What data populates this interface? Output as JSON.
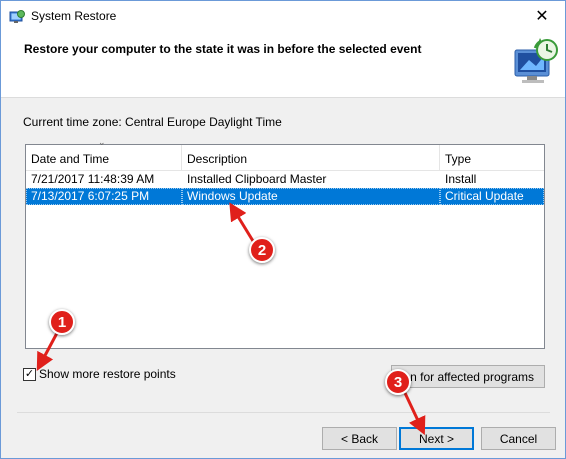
{
  "window": {
    "title": "System Restore",
    "close_glyph": "✕"
  },
  "header": {
    "title": "Restore your computer to the state it was in before the selected event"
  },
  "timezone": {
    "label": "Current time zone: Central Europe Daylight Time"
  },
  "table": {
    "columns": [
      "Date and Time",
      "Description",
      "Type"
    ],
    "rows": [
      {
        "datetime": "7/21/2017 11:48:39 AM",
        "description": "Installed Clipboard Master",
        "type": "Install"
      },
      {
        "datetime": "7/13/2017 6:07:25 PM",
        "description": "Windows Update",
        "type": "Critical Update"
      }
    ],
    "selected_row": 1
  },
  "show_more": {
    "label": "Show more restore points",
    "checked": true
  },
  "buttons": {
    "scan": "an for affected programs",
    "back": "< Back",
    "next": "Next >",
    "cancel": "Cancel"
  },
  "markers": {
    "m1": "1",
    "m2": "2",
    "m3": "3"
  },
  "icons": {
    "app": "system-restore-icon",
    "header": "computer-clock-icon"
  },
  "colors": {
    "selection": "#0078d7",
    "marker": "#e0201b"
  }
}
